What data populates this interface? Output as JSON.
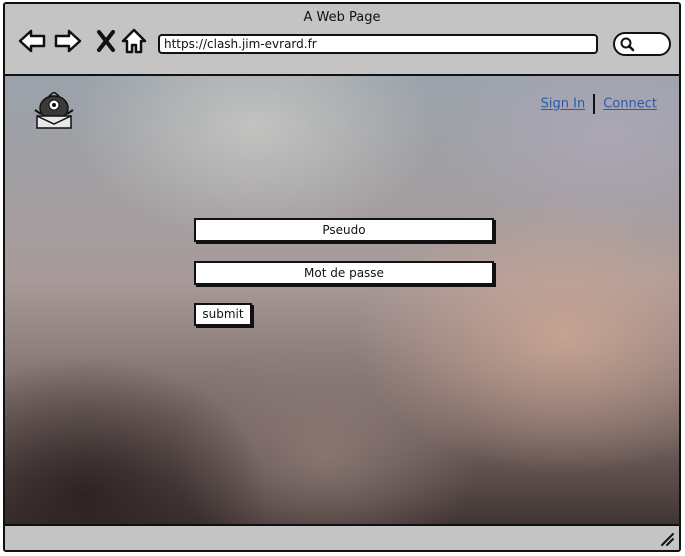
{
  "window": {
    "title": "A Web Page"
  },
  "toolbar": {
    "back_icon": "arrow-left-icon",
    "forward_icon": "arrow-right-icon",
    "close_icon": "close-icon",
    "home_icon": "home-icon",
    "url": "https://clash.jim-evrard.fr",
    "search_icon": "search-icon"
  },
  "header": {
    "logo_icon": "robot-mascot-logo",
    "sign_in": "Sign In",
    "connect": "Connect"
  },
  "form": {
    "pseudo_label": "Pseudo",
    "password_label": "Mot de passe",
    "submit_label": "submit"
  },
  "status": {
    "resize_icon": "resize-grip-icon"
  }
}
